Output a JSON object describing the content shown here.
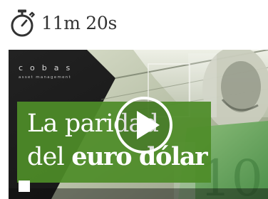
{
  "duration": {
    "icon": "stopwatch-icon",
    "text": "11m 20s"
  },
  "video": {
    "play_icon": "play-icon",
    "brand": {
      "name": "cobas",
      "tagline": "asset management"
    },
    "title": {
      "line1": "La paridad",
      "line2_regular": "del ",
      "line2_bold": "euro dólar"
    }
  },
  "colors": {
    "duration_text": "#333333",
    "title_panel": "#4e8c28",
    "text_on_video": "#ffffff"
  }
}
